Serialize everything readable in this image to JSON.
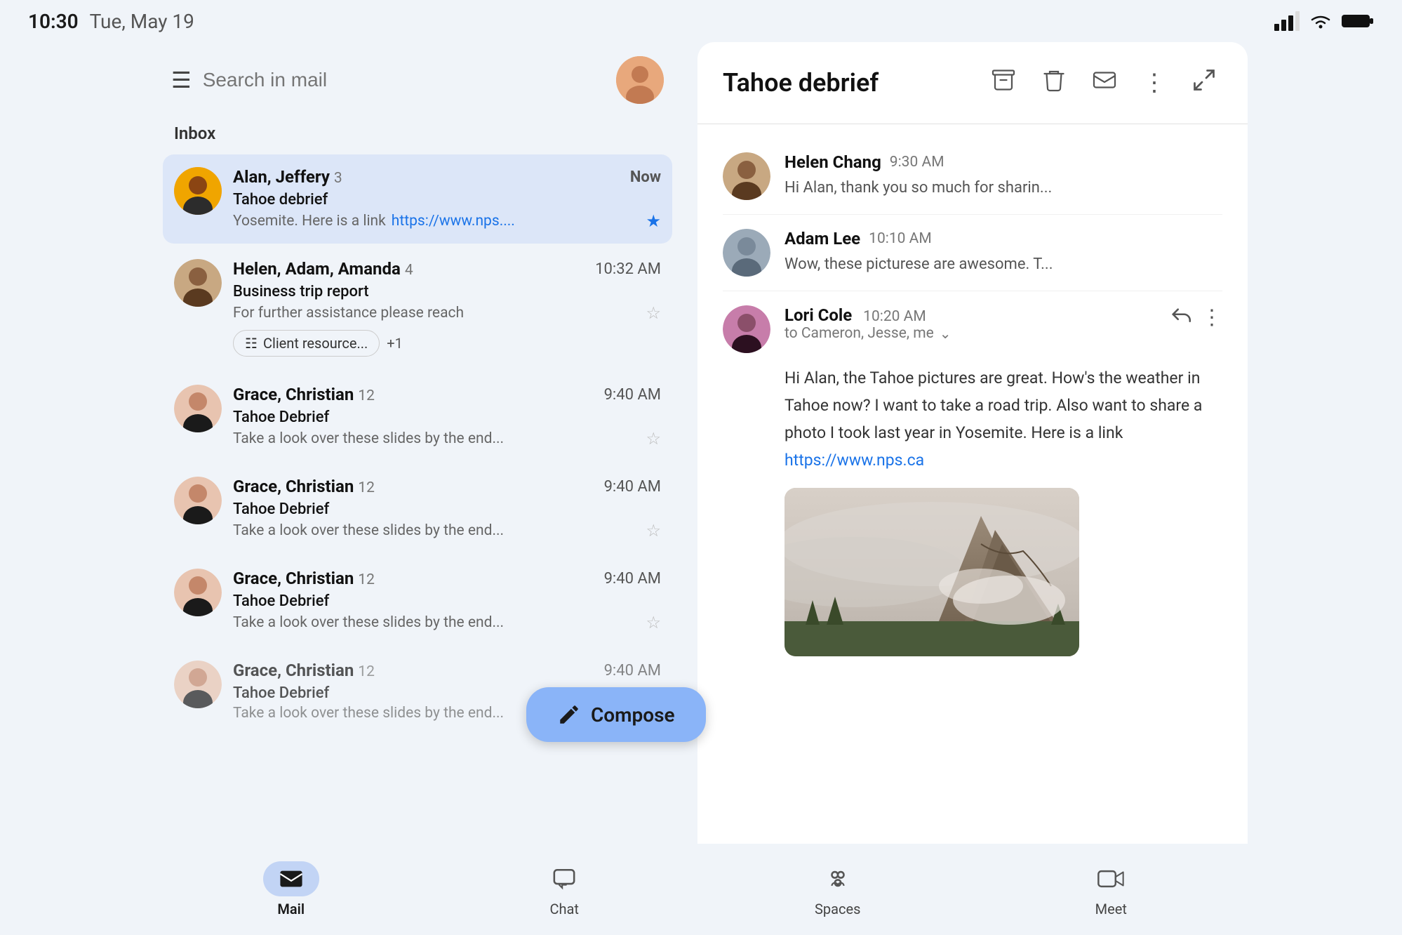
{
  "status": {
    "time": "10:30",
    "date": "Tue, May 19"
  },
  "search": {
    "placeholder": "Search in mail"
  },
  "inbox": {
    "label": "Inbox"
  },
  "emails": [
    {
      "id": 1,
      "sender": "Alan, Jeffery",
      "count": "3",
      "subject": "Tahoe debrief",
      "preview": "Yosemite. Here is a link",
      "link": "https://www.nps....",
      "time": "Now",
      "starred": true,
      "active": true,
      "avatar_type": "alan"
    },
    {
      "id": 2,
      "sender": "Helen, Adam, Amanda",
      "count": "4",
      "subject": "Business trip report",
      "preview": "For further assistance please reach",
      "time": "10:32 AM",
      "starred": false,
      "active": false,
      "avatar_type": "helen",
      "chips": [
        "Client resource...",
        "+1"
      ]
    },
    {
      "id": 3,
      "sender": "Grace, Christian",
      "count": "12",
      "subject": "Tahoe Debrief",
      "preview": "Take a look over these slides by the end...",
      "time": "9:40 AM",
      "starred": false,
      "active": false,
      "avatar_type": "grace"
    },
    {
      "id": 4,
      "sender": "Grace, Christian",
      "count": "12",
      "subject": "Tahoe Debrief",
      "preview": "Take a look over these slides by the end...",
      "time": "9:40 AM",
      "starred": false,
      "active": false,
      "avatar_type": "grace"
    },
    {
      "id": 5,
      "sender": "Grace, Christian",
      "count": "12",
      "subject": "Tahoe Debrief",
      "preview": "Take a look over these slides by the end...",
      "time": "9:40 AM",
      "starred": false,
      "active": false,
      "avatar_type": "grace"
    },
    {
      "id": 6,
      "sender": "Grace, Christian",
      "count": "12",
      "subject": "Tahoe Debrief",
      "preview": "Take a look over these slides by the end...",
      "time": "9:40 AM",
      "starred": false,
      "active": false,
      "avatar_type": "grace"
    }
  ],
  "detail": {
    "title": "Tahoe debrief",
    "actions": {
      "archive": "⬆",
      "delete": "🗑",
      "mail": "✉",
      "more": "⋮",
      "expand": "⤢"
    }
  },
  "threads": [
    {
      "sender": "Helen Chang",
      "time": "9:30 AM",
      "preview": "Hi Alan, thank you so much for sharin...",
      "avatar_type": "helen"
    },
    {
      "sender": "Adam Lee",
      "time": "10:10 AM",
      "preview": "Wow, these picturese are awesome. T...",
      "avatar_type": "adam"
    }
  ],
  "expanded_thread": {
    "sender": "Lori Cole",
    "time": "10:20 AM",
    "to": "to Cameron, Jesse, me",
    "body_1": "Hi Alan, the Tahoe pictures are great. How's the weather in Tahoe now? I want to take a road trip. Also want to share a photo I took last year in Yosemite. Here is a link",
    "link": "https://www.nps.ca",
    "avatar_type": "lori"
  },
  "compose": {
    "label": "Compose"
  },
  "bottom_nav": [
    {
      "id": "mail",
      "label": "Mail",
      "active": true
    },
    {
      "id": "chat",
      "label": "Chat",
      "active": false
    },
    {
      "id": "spaces",
      "label": "Spaces",
      "active": false
    },
    {
      "id": "meet",
      "label": "Meet",
      "active": false
    }
  ]
}
